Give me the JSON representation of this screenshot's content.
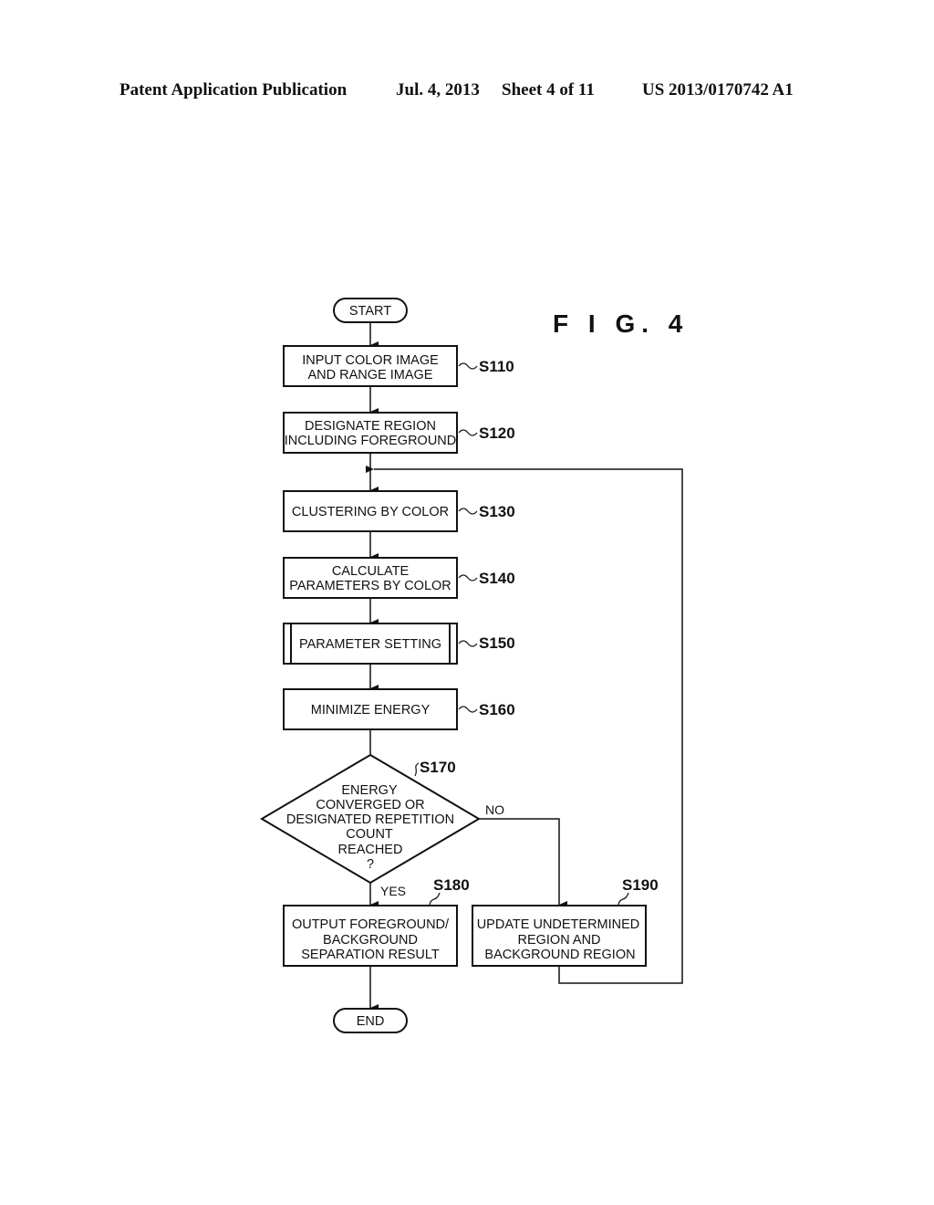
{
  "header": {
    "publication": "Patent Application Publication",
    "date": "Jul. 4, 2013",
    "sheet": "Sheet 4 of 11",
    "number": "US 2013/0170742 A1"
  },
  "figure_label": "F I G.  4",
  "terminals": {
    "start": "START",
    "end": "END"
  },
  "steps": {
    "s110": {
      "id": "S110",
      "lines": [
        "INPUT COLOR IMAGE",
        "AND RANGE IMAGE"
      ]
    },
    "s120": {
      "id": "S120",
      "lines": [
        "DESIGNATE REGION",
        "INCLUDING FOREGROUND"
      ]
    },
    "s130": {
      "id": "S130",
      "lines": [
        "CLUSTERING BY COLOR"
      ]
    },
    "s140": {
      "id": "S140",
      "lines": [
        "CALCULATE",
        "PARAMETERS BY COLOR"
      ]
    },
    "s150": {
      "id": "S150",
      "lines": [
        "PARAMETER SETTING"
      ]
    },
    "s160": {
      "id": "S160",
      "lines": [
        "MINIMIZE ENERGY"
      ]
    },
    "s170": {
      "id": "S170",
      "lines": [
        "ENERGY",
        "CONVERGED OR",
        "DESIGNATED REPETITION",
        "COUNT",
        "REACHED",
        "?"
      ]
    },
    "s180": {
      "id": "S180",
      "lines": [
        "OUTPUT FOREGROUND/",
        "BACKGROUND",
        "SEPARATION RESULT"
      ]
    },
    "s190": {
      "id": "S190",
      "lines": [
        "UPDATE UNDETERMINED",
        "REGION AND",
        "BACKGROUND REGION"
      ]
    }
  },
  "edges": {
    "yes": "YES",
    "no": "NO"
  }
}
